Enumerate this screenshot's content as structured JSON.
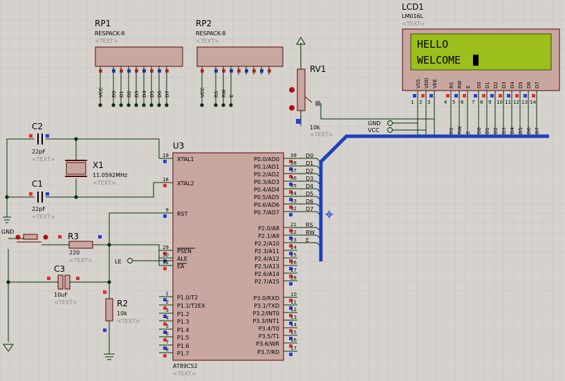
{
  "colors": {
    "background": "#d6d3ce",
    "grid": "#c8c4bf",
    "component_body": "#c9a7a1",
    "outline": "#5a0000",
    "wire": "#003000",
    "bus": "#1e3fbf",
    "lcd_screen": "#9cbf1c",
    "pin_red": "#e03030",
    "pin_blue": "#2b3cd6"
  },
  "rp1": {
    "ref": "RP1",
    "value": "RESPACK-8",
    "text": "<TEXT>",
    "pins": [
      "VCC",
      "D0",
      "D1",
      "D2",
      "D3",
      "D4",
      "D5",
      "D6",
      "D7"
    ]
  },
  "rp2": {
    "ref": "RP2",
    "value": "RESPACK-8",
    "text": "<TEXT>",
    "pins": [
      "VCC",
      "RS",
      "RW",
      "E"
    ]
  },
  "rv1": {
    "ref": "RV1",
    "value": "10k",
    "text": "<TEXT>"
  },
  "lcd": {
    "ref": "LCD1",
    "model": "LM016L",
    "text": "<TEXT>",
    "line1": "HELLO",
    "line2": "WELCOME",
    "pins": [
      "VSS",
      "VDD",
      "VEE",
      "RS",
      "RW",
      "E",
      "D0",
      "D1",
      "D2",
      "D3",
      "D4",
      "D5",
      "D6",
      "D7"
    ],
    "pin_numbers": [
      "1",
      "2",
      "3",
      "4",
      "5",
      "6",
      "7",
      "8",
      "9",
      "10",
      "11",
      "12",
      "13",
      "14"
    ],
    "net_labels": [
      "RS",
      "RW",
      "E",
      "D0",
      "D1",
      "D2",
      "D3",
      "D4",
      "D5",
      "D6",
      "D7"
    ]
  },
  "power": {
    "gnd": "GND",
    "vcc": "VCC"
  },
  "c2": {
    "ref": "C2",
    "value": "22pF",
    "text": "<TEXT>"
  },
  "c1": {
    "ref": "C1",
    "value": "22pF",
    "text": "<TEXT>"
  },
  "x1": {
    "ref": "X1",
    "value": "11.0592MHz",
    "text": "<TEXT>"
  },
  "r3": {
    "ref": "R3",
    "value": "220",
    "text": "<TEXT>"
  },
  "c3": {
    "ref": "C3",
    "value": "10uF",
    "text": "<TEXT>"
  },
  "r2": {
    "ref": "R2",
    "value": "10k",
    "text": "<TEXT>"
  },
  "gnd_label": "GND",
  "le_label": "LE",
  "u3": {
    "ref": "U3",
    "part": "AT89C52",
    "text": "<TEXT>",
    "left_pins": [
      {
        "num": "19",
        "name": "XTAL1"
      },
      {
        "num": "18",
        "name": "XTAL2"
      },
      {
        "num": "9",
        "name": "RST"
      },
      {
        "num": "29",
        "name": "PSEN"
      },
      {
        "num": "30",
        "name": "ALE"
      },
      {
        "num": "31",
        "name": "EA"
      },
      {
        "num": "1",
        "name": "P1.0/T2"
      },
      {
        "num": "2",
        "name": "P1.1/T2EX"
      },
      {
        "num": "3",
        "name": "P1.2"
      },
      {
        "num": "4",
        "name": "P1.3"
      },
      {
        "num": "5",
        "name": "P1.4"
      },
      {
        "num": "6",
        "name": "P1.5"
      },
      {
        "num": "7",
        "name": "P1.6"
      },
      {
        "num": "8",
        "name": "P1.7"
      }
    ],
    "right_pins": [
      {
        "num": "39",
        "name": "P0.0/AD0",
        "net": "D0"
      },
      {
        "num": "38",
        "name": "P0.1/AD1",
        "net": "D1"
      },
      {
        "num": "37",
        "name": "P0.2/AD2",
        "net": "D2"
      },
      {
        "num": "36",
        "name": "P0.3/AD3",
        "net": "D3"
      },
      {
        "num": "35",
        "name": "P0.4/AD4",
        "net": "D4"
      },
      {
        "num": "34",
        "name": "P0.5/AD5",
        "net": "D5"
      },
      {
        "num": "33",
        "name": "P0.6/AD6",
        "net": "D6"
      },
      {
        "num": "32",
        "name": "P0.7/AD7",
        "net": "D7"
      },
      {
        "num": "21",
        "name": "P2.0/A8",
        "net": "RS"
      },
      {
        "num": "22",
        "name": "P2.1/A9",
        "net": "RW"
      },
      {
        "num": "23",
        "name": "P2.2/A10",
        "net": "E"
      },
      {
        "num": "24",
        "name": "P2.3/A11",
        "net": ""
      },
      {
        "num": "25",
        "name": "P2.4/A12",
        "net": ""
      },
      {
        "num": "26",
        "name": "P2.5/A13",
        "net": ""
      },
      {
        "num": "27",
        "name": "P2.6/A14",
        "net": ""
      },
      {
        "num": "28",
        "name": "P2.7/A15",
        "net": ""
      },
      {
        "num": "10",
        "name": "P3.0/RXD",
        "net": ""
      },
      {
        "num": "11",
        "name": "P3.1/TXD",
        "net": ""
      },
      {
        "num": "12",
        "name": "P3.2/INT0",
        "net": ""
      },
      {
        "num": "13",
        "name": "P3.3/INT1",
        "net": ""
      },
      {
        "num": "14",
        "name": "P3.4/T0",
        "net": ""
      },
      {
        "num": "15",
        "name": "P3.5/T1",
        "net": ""
      },
      {
        "num": "16",
        "name": "P3.6/WR",
        "net": ""
      },
      {
        "num": "17",
        "name": "P3.7/RD",
        "net": ""
      }
    ]
  }
}
